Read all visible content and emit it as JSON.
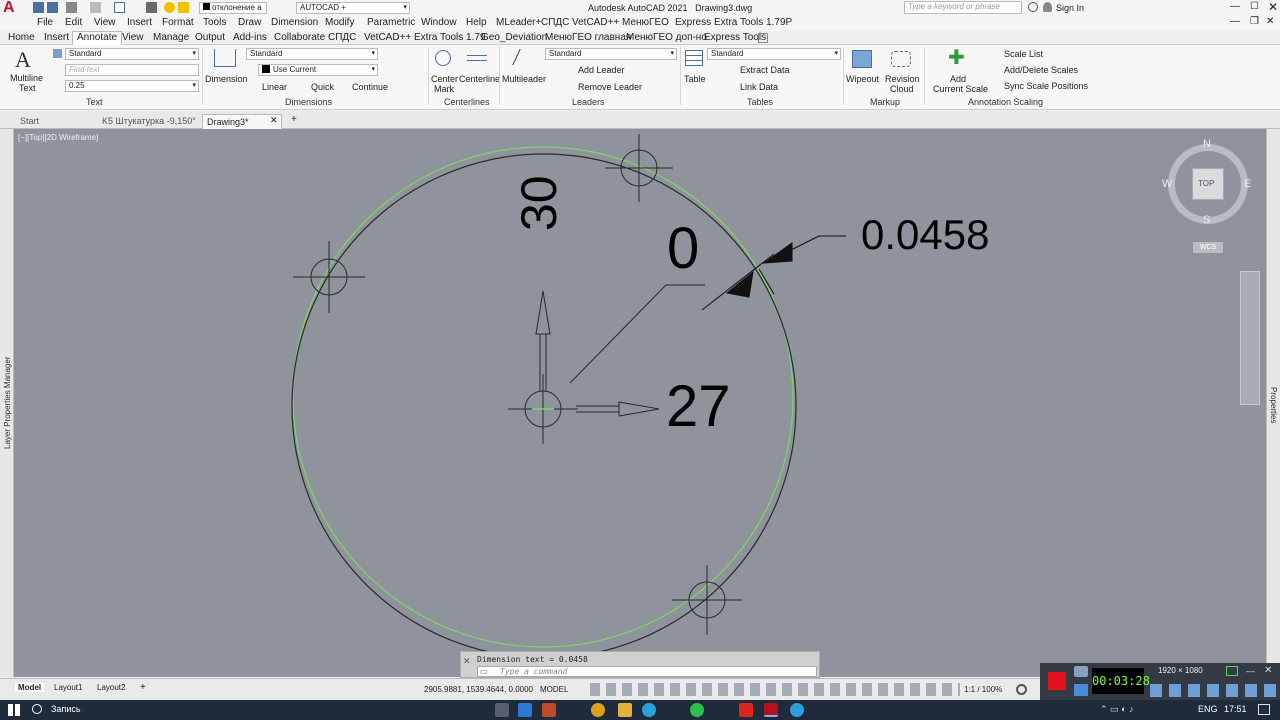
{
  "titlebar": {
    "app_title": "Autodesk AutoCAD 2021",
    "file_name": "Drawing3.dwg",
    "layer_combo": "отклонение а",
    "workspace_combo": "AUTOCAD +",
    "search_placeholder": "Type a keyword or phrase",
    "sign_in": "Sign In"
  },
  "menubar": {
    "items": [
      "File",
      "Edit",
      "View",
      "Insert",
      "Format",
      "Tools",
      "Draw",
      "Dimension",
      "Modify",
      "Parametric",
      "Window",
      "Help",
      "MLeader+",
      "СПДС",
      "VetCAD++",
      "МенюГЕО",
      "Express",
      "Extra Tools 1.79P"
    ]
  },
  "ribbon_tabs": {
    "items": [
      "Home",
      "Insert",
      "Annotate",
      "View",
      "Manage",
      "Output",
      "Add-ins",
      "Collaborate",
      "СПДС",
      "VetCAD++",
      "Extra Tools 1.79",
      "Geo_Deviation",
      "МенюГЕО главная",
      "МенюГЕО доп-но",
      "Express Tools"
    ],
    "active": "Annotate"
  },
  "ribbon": {
    "text_panel": {
      "multiline_text": "Multiline",
      "multiline_text2": "Text",
      "style": "Standard",
      "find_text_placeholder": "Find text",
      "height": "0.25",
      "title": "Text"
    },
    "dimensions_panel": {
      "dimension": "Dimension",
      "style": "Standard",
      "layer": "Use Current",
      "linear": "Linear",
      "quick": "Quick",
      "continue": "Continue",
      "title": "Dimensions"
    },
    "centerlines_panel": {
      "center_mark": "Center",
      "center_mark2": "Mark",
      "centerline": "Centerline",
      "title": "Centerlines"
    },
    "leaders_panel": {
      "multileader": "Multileader",
      "style": "Standard",
      "add_leader": "Add Leader",
      "remove_leader": "Remove Leader",
      "title": "Leaders"
    },
    "tables_panel": {
      "table": "Table",
      "style": "Standard",
      "extract_data": "Extract Data",
      "link_data": "Link Data",
      "title": "Tables"
    },
    "markup_panel": {
      "wipeout": "Wipeout",
      "revision": "Revision",
      "revision2": "Cloud",
      "title": "Markup"
    },
    "scaling_panel": {
      "add": "Add",
      "current_scale": "Current Scale",
      "scale_list": "Scale List",
      "add_delete": "Add/Delete Scales",
      "sync": "Sync Scale Positions",
      "title": "Annotation Scaling"
    }
  },
  "doc_tabs": {
    "items": [
      "Start",
      "K5 Штукатурка -9,150°",
      "Drawing3*"
    ],
    "active": "Drawing3*"
  },
  "viewport": {
    "label": "[−][Top][2D Wireframe]",
    "dims": {
      "vertical": "30",
      "zero": "0",
      "deviation": "0.0458",
      "horizontal": "27"
    },
    "viewcube": {
      "n": "N",
      "s": "S",
      "e": "E",
      "w": "W",
      "top": "TOP",
      "wcs": "WCS"
    }
  },
  "side_labels": {
    "left": "Layer Properties Manager",
    "right": "Properties"
  },
  "command": {
    "history": "Dimension text = 0.0458",
    "placeholder": "Type a command"
  },
  "statusbar": {
    "layout_tabs": [
      "Model",
      "Layout1",
      "Layout2"
    ],
    "coords": "2905.9881, 1539.4644, 0.0000",
    "model": "MODEL",
    "scale": "1:1 / 100%",
    "recorder_time": "00:03:28",
    "resolution": "1920 × 1080"
  },
  "taskbar": {
    "search": "Запись",
    "lang": "ENG",
    "clock": "17:51"
  },
  "colors": {
    "canvas": "#8f939b",
    "green_circle": "#7fd46a",
    "dim_text": "#000000"
  }
}
